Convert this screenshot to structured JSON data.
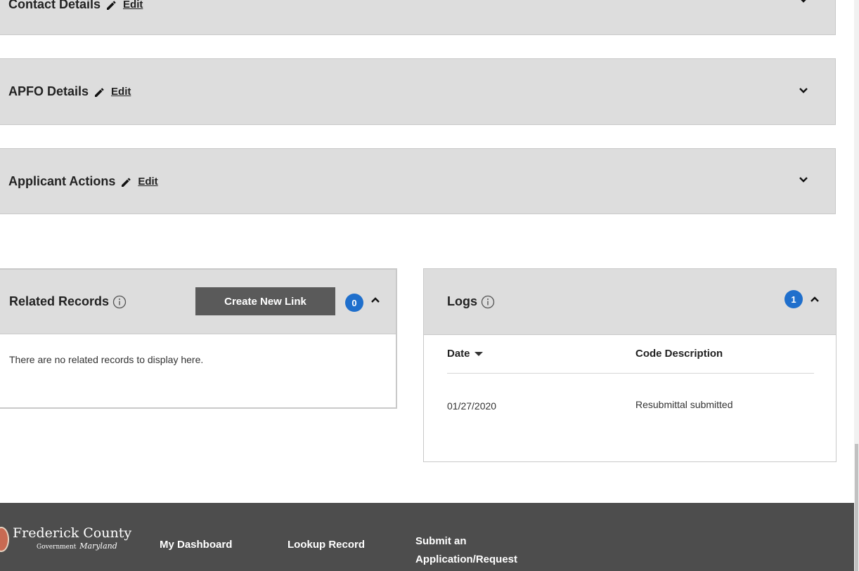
{
  "sections": {
    "contact": {
      "title": "Contact Details",
      "edit": "Edit"
    },
    "apfo": {
      "title": "APFO Details",
      "edit": "Edit"
    },
    "applicant": {
      "title": "Applicant Actions",
      "edit": "Edit"
    }
  },
  "related_records": {
    "title": "Related Records",
    "create_button": "Create New Link",
    "count": "0",
    "empty_message": "There are no related records to display here."
  },
  "logs": {
    "title": "Logs",
    "count": "1",
    "columns": {
      "date": "Date",
      "code_description": "Code Description"
    },
    "rows": [
      {
        "date": "01/27/2020",
        "description": "Resubmittal submitted"
      }
    ]
  },
  "footer": {
    "logo": {
      "name": "Frederick County",
      "sub": "Government",
      "script": "Maryland"
    },
    "links": {
      "dashboard": "My Dashboard",
      "lookup": "Lookup Record",
      "submit_line1": "Submit an",
      "submit_line2": "Application/Request"
    }
  },
  "colors": {
    "accent": "#1f6fcc",
    "header_bg": "#dddddd",
    "footer_bg": "#4d4d4d",
    "button_bg": "#5a5a5a"
  }
}
